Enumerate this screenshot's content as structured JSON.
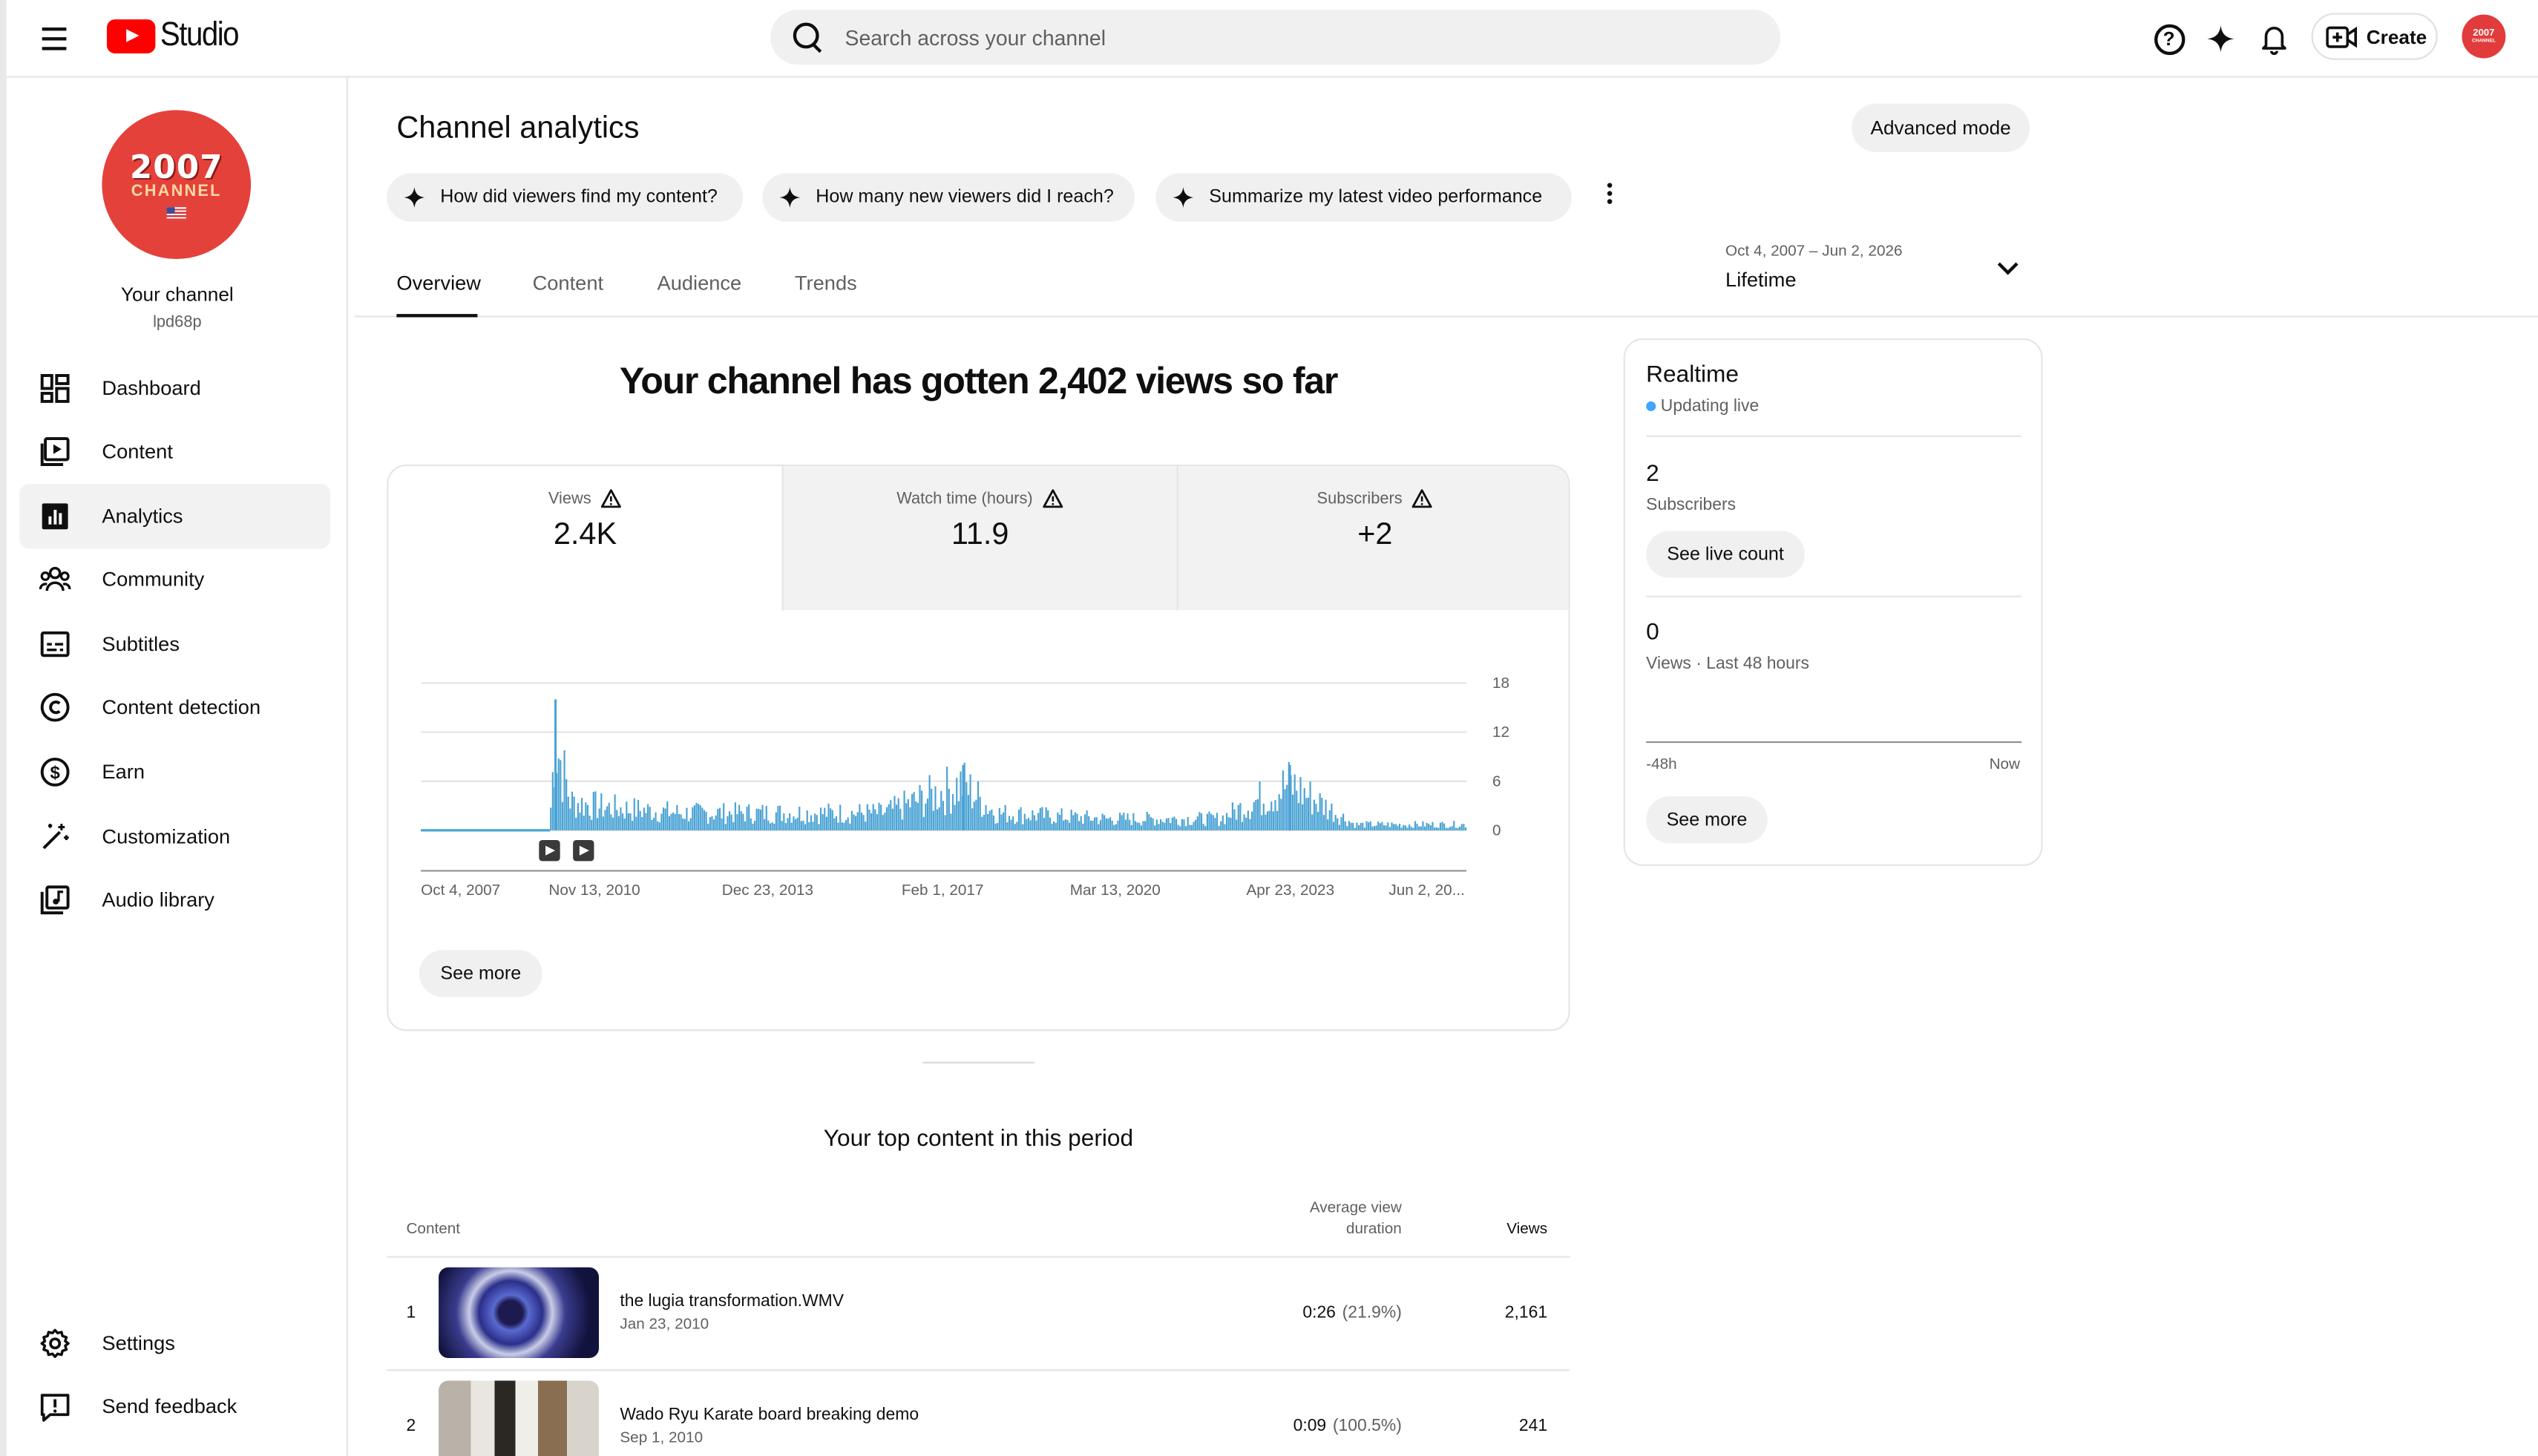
{
  "header": {
    "logo_text": "Studio",
    "search_placeholder": "Search across your channel",
    "create_label": "Create",
    "avatar_text": "2007",
    "avatar_sub": "CHANNEL"
  },
  "sidebar": {
    "avatar_year": "2007",
    "avatar_word": "CHANNEL",
    "channel_name": "Your channel",
    "channel_handle": "lpd68p",
    "items": [
      {
        "label": "Dashboard",
        "icon": "dashboard-icon"
      },
      {
        "label": "Content",
        "icon": "content-icon"
      },
      {
        "label": "Analytics",
        "icon": "analytics-icon",
        "active": true
      },
      {
        "label": "Community",
        "icon": "community-icon"
      },
      {
        "label": "Subtitles",
        "icon": "subtitles-icon"
      },
      {
        "label": "Content detection",
        "icon": "copyright-icon"
      },
      {
        "label": "Earn",
        "icon": "dollar-icon"
      },
      {
        "label": "Customization",
        "icon": "magic-wand-icon"
      },
      {
        "label": "Audio library",
        "icon": "audio-library-icon"
      }
    ],
    "bottom_items": [
      {
        "label": "Settings",
        "icon": "gear-icon"
      },
      {
        "label": "Send feedback",
        "icon": "feedback-icon"
      }
    ]
  },
  "main": {
    "title": "Channel analytics",
    "advanced_mode_label": "Advanced mode",
    "chips": [
      "How did viewers find my content?",
      "How many new viewers did I reach?",
      "Summarize my latest video performance"
    ],
    "tabs": [
      "Overview",
      "Content",
      "Audience",
      "Trends"
    ],
    "active_tab": "Overview",
    "date_range": "Oct 4, 2007 – Jun 2, 2026",
    "date_label": "Lifetime",
    "headline": "Your channel has gotten 2,402 views so far",
    "metrics": [
      {
        "label": "Views",
        "value": "2.4K"
      },
      {
        "label": "Watch time (hours)",
        "value": "11.9"
      },
      {
        "label": "Subscribers",
        "value": "+2"
      }
    ],
    "see_more_label": "See more",
    "top_content_title": "Your top content in this period",
    "table_headers": {
      "content": "Content",
      "avg_view_line1": "Average view",
      "avg_view_line2": "duration",
      "views": "Views"
    },
    "rows": [
      {
        "rank": "1",
        "title": "the lugia transformation.WMV",
        "date": "Jan 23, 2010",
        "avg": "0:26",
        "pct": "(21.9%)",
        "views": "2,161"
      },
      {
        "rank": "2",
        "title": "Wado Ryu Karate board breaking demo",
        "date": "Sep 1, 2010",
        "avg": "0:09",
        "pct": "(100.5%)",
        "views": "241"
      }
    ]
  },
  "realtime": {
    "title": "Realtime",
    "live_label": "Updating live",
    "subscribers_value": "2",
    "subscribers_label": "Subscribers",
    "see_live_label": "See live count",
    "views_value": "0",
    "views_label": "Views · Last 48 hours",
    "axis_start": "-48h",
    "axis_end": "Now",
    "see_more_label": "See more"
  },
  "colors": {
    "accent": "#3ea6ff",
    "chart_bar": "#4ba3d4",
    "brand_red": "#ff0000"
  },
  "chart_data": {
    "type": "bar",
    "title": "",
    "xlabel": "",
    "ylabel": "",
    "ylim": [
      0,
      18
    ],
    "yticks": [
      0,
      6,
      12,
      18
    ],
    "x_tick_labels": [
      "Oct 4, 2007",
      "Nov 13, 2010",
      "Dec 23, 2013",
      "Feb 1, 2017",
      "Mar 13, 2020",
      "Apr 23, 2023",
      "Jun 2, 20..."
    ],
    "x_range": [
      "2007-10-04",
      "2026-06-02"
    ],
    "series": [
      {
        "name": "Views",
        "description_points": [
          {
            "x": "2007-10-04",
            "y": 0
          },
          {
            "x": "2009-12-15",
            "y": 0
          },
          {
            "x": "2010-01-23",
            "y": 4
          },
          {
            "x": "2010-02-20",
            "y": 16
          },
          {
            "x": "2010-06-01",
            "y": 5
          },
          {
            "x": "2011-01-01",
            "y": 4
          },
          {
            "x": "2012-06-01",
            "y": 3
          },
          {
            "x": "2014-01-01",
            "y": 3
          },
          {
            "x": "2016-01-01",
            "y": 3
          },
          {
            "x": "2017-06-01",
            "y": 8
          },
          {
            "x": "2018-01-01",
            "y": 3
          },
          {
            "x": "2020-01-01",
            "y": 2
          },
          {
            "x": "2022-01-01",
            "y": 2
          },
          {
            "x": "2023-04-01",
            "y": 8
          },
          {
            "x": "2024-06-01",
            "y": 1
          },
          {
            "x": "2026-06-02",
            "y": 1
          }
        ]
      }
    ],
    "grid": true,
    "legend": "none"
  }
}
